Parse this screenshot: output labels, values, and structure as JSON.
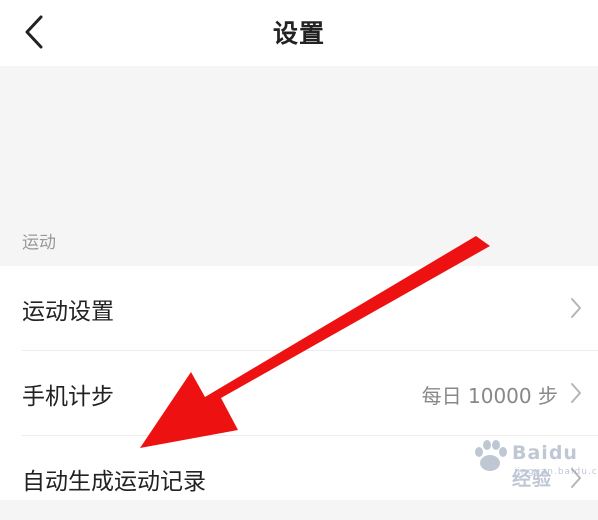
{
  "header": {
    "title": "设置",
    "back_icon": "chevron-left-icon"
  },
  "section": {
    "label": "运动"
  },
  "rows": [
    {
      "label": "运动设置",
      "value": "",
      "icon": "chevron-right-icon"
    },
    {
      "label": "手机计步",
      "value": "每日 10000 步",
      "icon": "chevron-right-icon"
    },
    {
      "label": "自动生成运动记录",
      "value": "",
      "icon": "chevron-right-icon"
    }
  ],
  "overlay": {
    "arrow_color": "#ee1111"
  },
  "watermark": {
    "brand": "Baidu经验",
    "url": "jingyan.baidu.com"
  }
}
